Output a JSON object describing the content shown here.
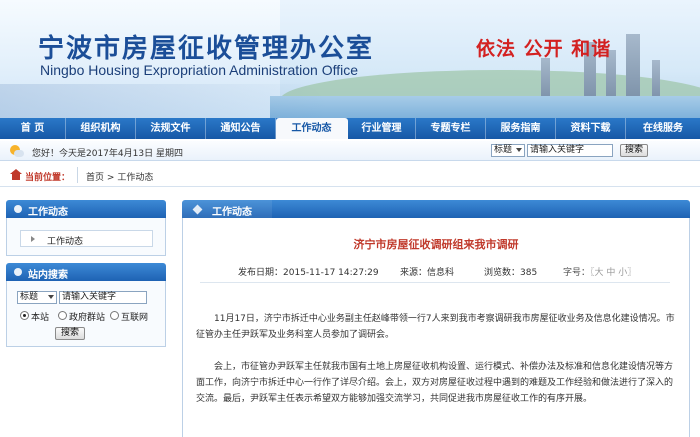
{
  "header": {
    "title_cn": "宁波市房屋征收管理办公室",
    "title_en": "Ningbo Housing Expropriation Administration Office",
    "slogan": "依法 公开 和谐"
  },
  "nav": {
    "items": [
      {
        "label": "首 页",
        "active": false
      },
      {
        "label": "组织机构",
        "active": false
      },
      {
        "label": "法规文件",
        "active": false
      },
      {
        "label": "通知公告",
        "active": false
      },
      {
        "label": "工作动态",
        "active": true
      },
      {
        "label": "行业管理",
        "active": false
      },
      {
        "label": "专题专栏",
        "active": false
      },
      {
        "label": "服务指南",
        "active": false
      },
      {
        "label": "资料下载",
        "active": false
      },
      {
        "label": "在线服务",
        "active": false
      }
    ]
  },
  "infobar": {
    "greeting": "您好！今天是2017年4月13日 星期四",
    "search_scope": "标题",
    "search_placeholder": "请输入关键字",
    "search_button": "搜索"
  },
  "breadcrumb": {
    "label": "当前位置：",
    "home": "首页",
    "sep": ">",
    "current": "工作动态"
  },
  "sidebar": {
    "section_title": "工作动态",
    "links": [
      "工作动态"
    ],
    "search_title": "站内搜索",
    "search_scope": "标题",
    "search_placeholder": "请输入关键字",
    "radios": [
      {
        "label": "本站",
        "checked": true
      },
      {
        "label": "政府群站",
        "checked": false
      },
      {
        "label": "互联网",
        "checked": false
      }
    ],
    "search_button": "搜索"
  },
  "main": {
    "section_title": "工作动态",
    "article": {
      "title": "济宁市房屋征收调研组来我市调研",
      "date_label": "发布日期：",
      "date": "2015-11-17 14:27:29",
      "source_label": "来源：",
      "source": "信息科",
      "views_label": "浏览数：",
      "views": "385",
      "font_label": "字号：",
      "font_options": "〖大 中 小〗",
      "paragraphs": [
        "11月17日，济宁市拆迁中心业务副主任赵峰带领一行7人来到我市考察调研我市房屋征收业务及信息化建设情况。市征管办主任尹跃军及业务科室人员参加了调研会。",
        "会上，市征管办尹跃军主任就我市国有土地上房屋征收机构设置、运行模式、补偿办法及标准和信息化建设情况等方面工作，向济宁市拆迁中心一行作了详尽介绍。会上，双方对房屋征收过程中遇到的难题及工作经验和做法进行了深入的交流。最后，尹跃军主任表示希望双方能够加强交流学习，共同促进我市房屋征收工作的有序开展。"
      ]
    }
  },
  "colors": {
    "nav_blue": "#1758a6",
    "title_red": "#c0392b",
    "slogan_red": "#d32121",
    "header_blue": "#1b4e98"
  }
}
